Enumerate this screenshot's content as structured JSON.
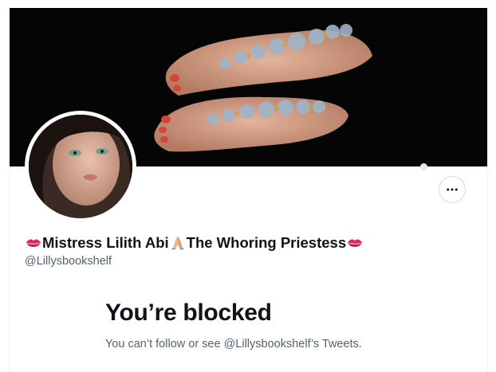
{
  "profile": {
    "display_name": "Mistress Lilith Abi",
    "display_name_suffix": "The Whoring Priestess",
    "handle": "@Lillysbookshelf",
    "name_icons": [
      "kiss-mark-icon",
      "folded-hands-icon",
      "kiss-mark-icon"
    ]
  },
  "banner": {
    "description_icon": "banner-image"
  },
  "actions": {
    "more_icon": "more-icon"
  },
  "blocked": {
    "title": "You’re blocked",
    "message": "You can’t follow or see @Lillysbookshelf’s Tweets."
  },
  "colors": {
    "text_primary": "#0f1419",
    "text_secondary": "#536471",
    "border": "#cfd9de",
    "banner_bg": "#050505",
    "kiss_red": "#e0245e"
  }
}
